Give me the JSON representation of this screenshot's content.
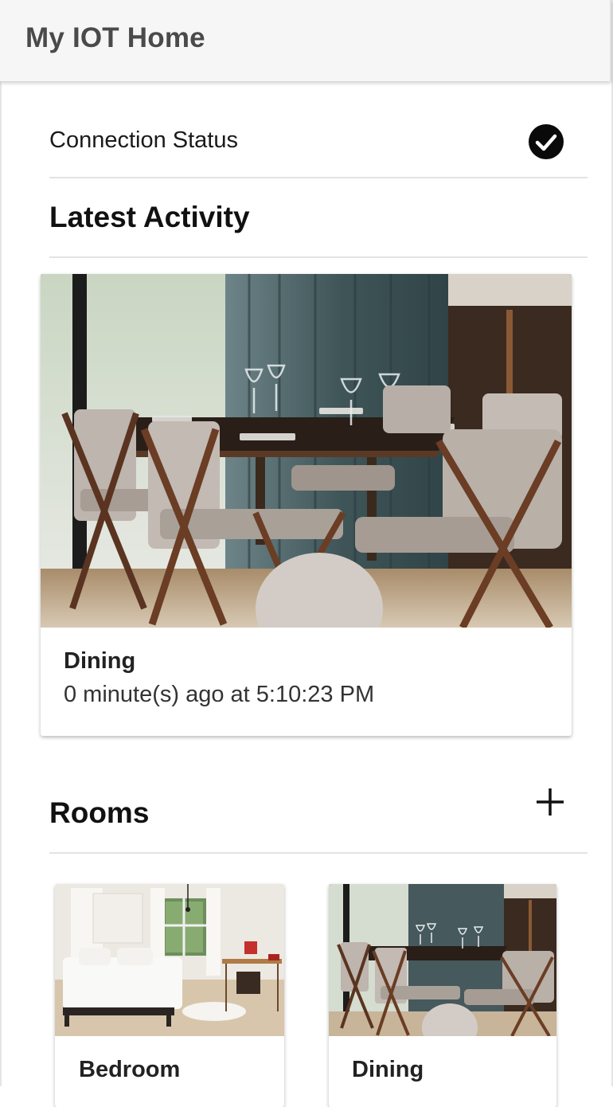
{
  "app": {
    "title": "My IOT Home"
  },
  "connection": {
    "label": "Connection Status",
    "status_icon": "check-circle-icon"
  },
  "latest_activity": {
    "heading": "Latest Activity",
    "card": {
      "room": "Dining",
      "time_text": "0 minute(s) ago at 5:10:23 PM",
      "photo": "dining-room-photo"
    }
  },
  "rooms": {
    "heading": "Rooms",
    "add_icon": "plus-icon",
    "items": [
      {
        "label": "Bedroom",
        "photo": "bedroom-photo"
      },
      {
        "label": "Dining",
        "photo": "dining-room-photo"
      }
    ]
  },
  "colors": {
    "app_bar_bg": "#f6f6f6",
    "title_text": "#4a4a4a",
    "divider": "#e3e3e3"
  }
}
